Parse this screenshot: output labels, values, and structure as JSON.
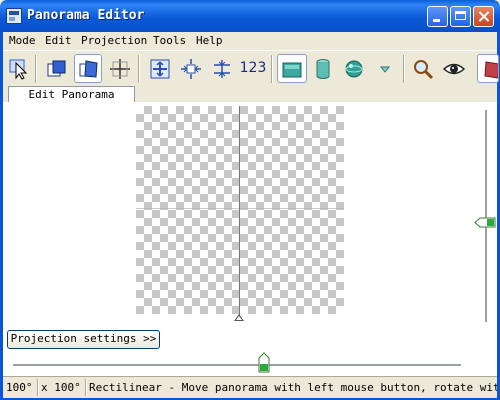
{
  "window": {
    "title": "Panorama Editor",
    "icon": "panorama-app-icon"
  },
  "menu": [
    "Mode",
    "Edit",
    "Projection",
    "Tools",
    "Help"
  ],
  "toolbar": {
    "buttons": [
      {
        "icon": "select-arrow-icon",
        "pressed": false
      },
      {
        "icon": "overlap-images-icon",
        "pressed": false
      },
      {
        "icon": "drag-layout-icon",
        "pressed": true
      },
      {
        "icon": "crosshair-icon",
        "pressed": false
      },
      {
        "icon": "fit-center-icon",
        "pressed": false
      },
      {
        "icon": "fit-horizontal-icon",
        "pressed": false
      },
      {
        "icon": "fit-vertical-icon",
        "pressed": false
      },
      {
        "icon": "numbers-icon",
        "label": "123",
        "pressed": false
      },
      {
        "icon": "rectilinear-projection-icon",
        "pressed": true
      },
      {
        "icon": "cylindrical-projection-icon",
        "pressed": false
      },
      {
        "icon": "spherical-projection-icon",
        "pressed": false
      },
      {
        "icon": "more-projections-icon",
        "pressed": false
      },
      {
        "icon": "zoom-magnifier-icon",
        "pressed": false
      },
      {
        "icon": "preview-eye-icon",
        "pressed": false
      },
      {
        "icon": "extra-tool-icon",
        "pressed": false
      }
    ]
  },
  "tabs": [
    {
      "label": "Edit Panorama",
      "active": true
    }
  ],
  "panel": {
    "projection_button": "Projection settings >>"
  },
  "sliders": {
    "horizontal_level": 0.56,
    "vertical_level": 0.53
  },
  "status": {
    "hfov": "100°",
    "vfov": "x 100°",
    "message": "Rectilinear - Move panorama with left mouse button, rotate with r"
  }
}
